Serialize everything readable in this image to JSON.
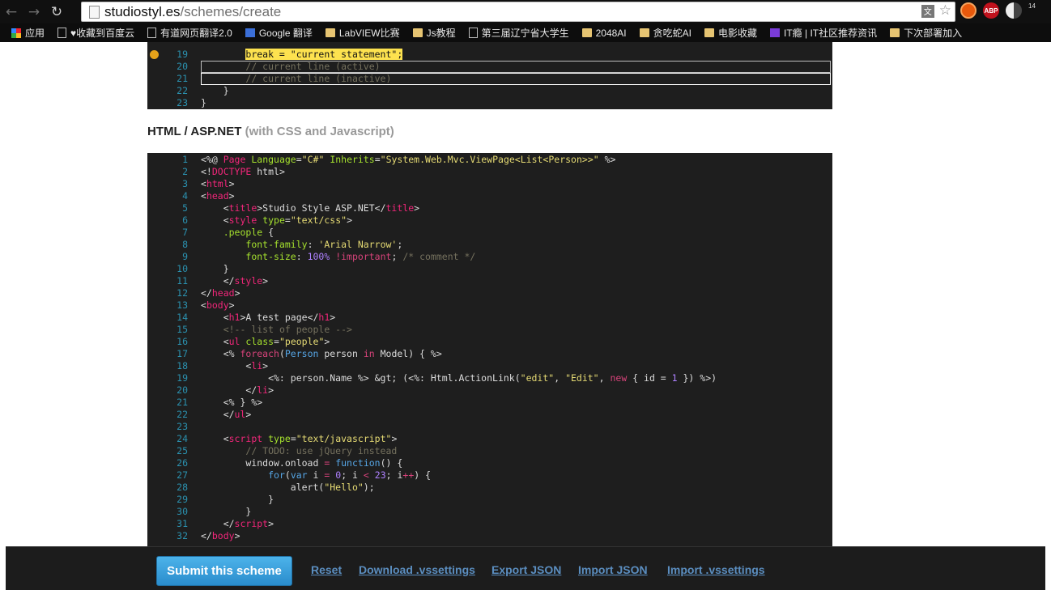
{
  "browser": {
    "url_domain": "studiostyl.es",
    "url_path": "/schemes/create",
    "extensions": [
      "ABP",
      "14"
    ]
  },
  "bookmarks": [
    {
      "label": "应用",
      "icon": "apps-grid-icon"
    },
    {
      "label": "♥收藏到百度云",
      "icon": "page-icon"
    },
    {
      "label": "有道网页翻译2.0",
      "icon": "page-icon"
    },
    {
      "label": "Google 翻译",
      "icon": "google-translate-icon"
    },
    {
      "label": "LabVIEW比赛",
      "icon": "folder-icon"
    },
    {
      "label": "Js教程",
      "icon": "folder-icon"
    },
    {
      "label": "第三届辽宁省大学生",
      "icon": "page-icon"
    },
    {
      "label": "2048AI",
      "icon": "folder-icon"
    },
    {
      "label": "贪吃蛇AI",
      "icon": "folder-icon"
    },
    {
      "label": "电影收藏",
      "icon": "folder-icon"
    },
    {
      "label": "IT瘾 | IT社区推荐资讯",
      "icon": "it-icon"
    },
    {
      "label": "下次部署加入",
      "icon": "folder-icon"
    }
  ],
  "top_snippet": {
    "lines": [
      {
        "num": "19",
        "code": "break = \"current statement\";"
      },
      {
        "num": "20",
        "code": "// current line (active)"
      },
      {
        "num": "21",
        "code": "// current line (inactive)"
      },
      {
        "num": "22",
        "code": "}"
      },
      {
        "num": "23",
        "code": "}"
      }
    ]
  },
  "section": {
    "title": "HTML / ASP.NET",
    "subtitle": "(with CSS and Javascript)"
  },
  "main_code": {
    "lines": [
      {
        "num": "1",
        "parts": [
          [
            "w",
            "<%@ "
          ],
          [
            "t",
            "Page"
          ],
          [
            "w",
            " "
          ],
          [
            "a",
            "Language"
          ],
          [
            "w",
            "="
          ],
          [
            "s",
            "\"C#\""
          ],
          [
            "w",
            " "
          ],
          [
            "a",
            "Inherits"
          ],
          [
            "w",
            "="
          ],
          [
            "s",
            "\"System.Web.Mvc.ViewPage<List<Person>>\""
          ],
          [
            "w",
            " %>"
          ]
        ]
      },
      {
        "num": "2",
        "parts": [
          [
            "w",
            "<!"
          ],
          [
            "t",
            "DOCTYPE"
          ],
          [
            "w",
            " html>"
          ]
        ]
      },
      {
        "num": "3",
        "parts": [
          [
            "w",
            "<"
          ],
          [
            "t",
            "html"
          ],
          [
            "w",
            ">"
          ]
        ]
      },
      {
        "num": "4",
        "parts": [
          [
            "w",
            "<"
          ],
          [
            "t",
            "head"
          ],
          [
            "w",
            ">"
          ]
        ]
      },
      {
        "num": "5",
        "parts": [
          [
            "w",
            "    <"
          ],
          [
            "t",
            "title"
          ],
          [
            "w",
            ">Studio Style ASP.NET</"
          ],
          [
            "t",
            "title"
          ],
          [
            "w",
            ">"
          ]
        ]
      },
      {
        "num": "6",
        "parts": [
          [
            "w",
            "    <"
          ],
          [
            "t",
            "style"
          ],
          [
            "w",
            " "
          ],
          [
            "a",
            "type"
          ],
          [
            "w",
            "="
          ],
          [
            "s",
            "\"text/css\""
          ],
          [
            "w",
            ">"
          ]
        ]
      },
      {
        "num": "7",
        "parts": [
          [
            "w",
            "    "
          ],
          [
            "a",
            ".people"
          ],
          [
            "w",
            " {"
          ]
        ]
      },
      {
        "num": "8",
        "parts": [
          [
            "w",
            "        "
          ],
          [
            "a",
            "font-family"
          ],
          [
            "w",
            ": "
          ],
          [
            "s",
            "'Arial Narrow'"
          ],
          [
            "w",
            ";"
          ]
        ]
      },
      {
        "num": "9",
        "parts": [
          [
            "w",
            "        "
          ],
          [
            "a",
            "font-size"
          ],
          [
            "w",
            ": "
          ],
          [
            "n",
            "100%"
          ],
          [
            "w",
            " "
          ],
          [
            "k",
            "!important"
          ],
          [
            "w",
            "; "
          ],
          [
            "c",
            "/* comment */"
          ]
        ]
      },
      {
        "num": "10",
        "parts": [
          [
            "w",
            "    }"
          ]
        ]
      },
      {
        "num": "11",
        "parts": [
          [
            "w",
            "    </"
          ],
          [
            "t",
            "style"
          ],
          [
            "w",
            ">"
          ]
        ]
      },
      {
        "num": "12",
        "parts": [
          [
            "w",
            "</"
          ],
          [
            "t",
            "head"
          ],
          [
            "w",
            ">"
          ]
        ]
      },
      {
        "num": "13",
        "parts": [
          [
            "w",
            "<"
          ],
          [
            "t",
            "body"
          ],
          [
            "w",
            ">"
          ]
        ]
      },
      {
        "num": "14",
        "parts": [
          [
            "w",
            "    <"
          ],
          [
            "t",
            "h1"
          ],
          [
            "w",
            ">A test page</"
          ],
          [
            "t",
            "h1"
          ],
          [
            "w",
            ">"
          ]
        ]
      },
      {
        "num": "15",
        "parts": [
          [
            "w",
            "    "
          ],
          [
            "c",
            "<!-- list of people -->"
          ]
        ]
      },
      {
        "num": "16",
        "parts": [
          [
            "w",
            "    <"
          ],
          [
            "t",
            "ul"
          ],
          [
            "w",
            " "
          ],
          [
            "a",
            "class"
          ],
          [
            "w",
            "="
          ],
          [
            "s",
            "\"people\""
          ],
          [
            "w",
            ">"
          ]
        ]
      },
      {
        "num": "17",
        "parts": [
          [
            "w",
            "    <% "
          ],
          [
            "k",
            "foreach"
          ],
          [
            "w",
            "("
          ],
          [
            "ty",
            "Person"
          ],
          [
            "w",
            " person "
          ],
          [
            "k",
            "in"
          ],
          [
            "w",
            " Model) { %>"
          ]
        ]
      },
      {
        "num": "18",
        "parts": [
          [
            "w",
            "        <"
          ],
          [
            "t",
            "li"
          ],
          [
            "w",
            ">"
          ]
        ]
      },
      {
        "num": "19",
        "parts": [
          [
            "w",
            "            <%: person.Name %> &gt; (<%: Html.ActionLink("
          ],
          [
            "s",
            "\"edit\""
          ],
          [
            "w",
            ", "
          ],
          [
            "s",
            "\"Edit\""
          ],
          [
            "w",
            ", "
          ],
          [
            "k",
            "new"
          ],
          [
            "w",
            " { id = "
          ],
          [
            "n",
            "1"
          ],
          [
            "w",
            " }) %>)"
          ]
        ]
      },
      {
        "num": "20",
        "parts": [
          [
            "w",
            "        </"
          ],
          [
            "t",
            "li"
          ],
          [
            "w",
            ">"
          ]
        ]
      },
      {
        "num": "21",
        "parts": [
          [
            "w",
            "    <% } %>"
          ]
        ]
      },
      {
        "num": "22",
        "parts": [
          [
            "w",
            "    </"
          ],
          [
            "t",
            "ul"
          ],
          [
            "w",
            ">"
          ]
        ]
      },
      {
        "num": "23",
        "parts": [
          [
            "w",
            ""
          ]
        ]
      },
      {
        "num": "24",
        "parts": [
          [
            "w",
            "    <"
          ],
          [
            "t",
            "script"
          ],
          [
            "w",
            " "
          ],
          [
            "a",
            "type"
          ],
          [
            "w",
            "="
          ],
          [
            "s",
            "\"text/javascript\""
          ],
          [
            "w",
            ">"
          ]
        ]
      },
      {
        "num": "25",
        "parts": [
          [
            "w",
            "        "
          ],
          [
            "c",
            "// TODO: use jQuery instead"
          ]
        ]
      },
      {
        "num": "26",
        "parts": [
          [
            "w",
            "        window.onload "
          ],
          [
            "k",
            "="
          ],
          [
            "w",
            " "
          ],
          [
            "ty",
            "function"
          ],
          [
            "w",
            "() {"
          ]
        ]
      },
      {
        "num": "27",
        "parts": [
          [
            "w",
            "            "
          ],
          [
            "ty",
            "for"
          ],
          [
            "w",
            "("
          ],
          [
            "ty",
            "var"
          ],
          [
            "w",
            " i "
          ],
          [
            "k",
            "="
          ],
          [
            "w",
            " "
          ],
          [
            "n",
            "0"
          ],
          [
            "w",
            "; i "
          ],
          [
            "k",
            "<"
          ],
          [
            "w",
            " "
          ],
          [
            "n",
            "23"
          ],
          [
            "w",
            "; i"
          ],
          [
            "k",
            "++"
          ],
          [
            "w",
            ") {"
          ]
        ]
      },
      {
        "num": "28",
        "parts": [
          [
            "w",
            "                alert("
          ],
          [
            "s",
            "\"Hello\""
          ],
          [
            "w",
            ");"
          ]
        ]
      },
      {
        "num": "29",
        "parts": [
          [
            "w",
            "            }"
          ]
        ]
      },
      {
        "num": "30",
        "parts": [
          [
            "w",
            "        }"
          ]
        ]
      },
      {
        "num": "31",
        "parts": [
          [
            "w",
            "    </"
          ],
          [
            "t",
            "script"
          ],
          [
            "w",
            ">"
          ]
        ]
      },
      {
        "num": "32",
        "parts": [
          [
            "w",
            "</"
          ],
          [
            "t",
            "body"
          ],
          [
            "w",
            ">"
          ]
        ]
      }
    ]
  },
  "actions": {
    "submit": "Submit this scheme",
    "reset": "Reset",
    "download": "Download .vssettings",
    "export_json": "Export JSON",
    "import_json": "Import JSON",
    "import_vs": "Import .vssettings"
  },
  "colors": {
    "editor_bg": "#1e1e1e",
    "line_number": "#2b91af",
    "tag": "#f2267a",
    "string": "#e6db74",
    "attribute": "#a6e22e",
    "comment": "#75715e",
    "number": "#ae81ff",
    "breakpoint_highlight": "#fde24f",
    "link": "#5b8ec0"
  }
}
